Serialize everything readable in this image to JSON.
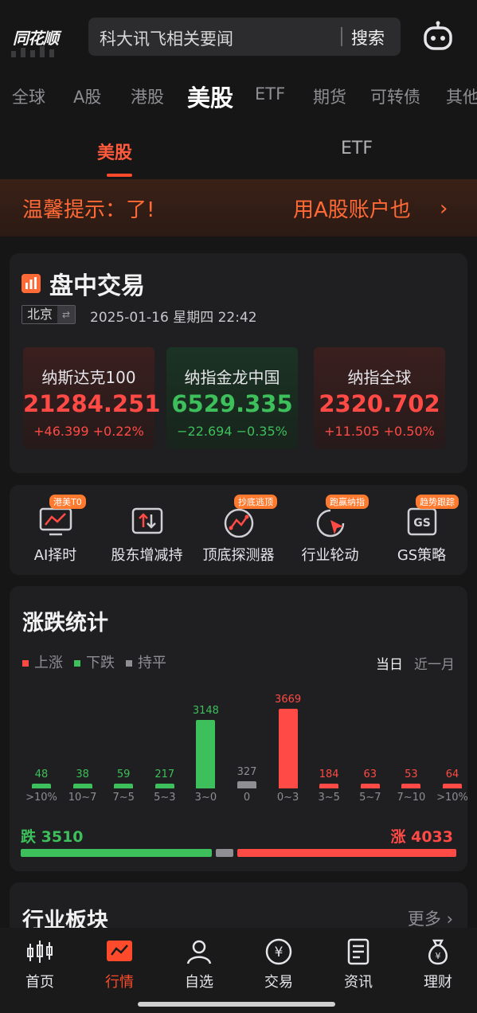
{
  "app": {
    "logo_text": "同花顺"
  },
  "search": {
    "placeholder": "科大讯飞相关要闻",
    "button": "搜索"
  },
  "market_tabs": [
    "全球",
    "A股",
    "港股",
    "美股",
    "ETF",
    "期货",
    "可转债",
    "其他"
  ],
  "market_tabs_active": "美股",
  "sub_tabs": [
    "美股",
    "ETF"
  ],
  "sub_tabs_active": "美股",
  "notice": {
    "left_text": "温馨提示：了!",
    "right_text": "用A股账户也"
  },
  "intraday": {
    "title": "盘中交易",
    "city": "北京",
    "datetime": "2025-01-16 星期四   22:42",
    "indices": [
      {
        "name": "纳斯达克100",
        "value": "21284.251",
        "change": "+46.399 +0.22%",
        "direction": "up"
      },
      {
        "name": "纳指金龙中国",
        "value": "6529.335",
        "change": "−22.694 −0.35%",
        "direction": "down"
      },
      {
        "name": "纳指全球",
        "value": "2320.702",
        "change": "+11.505 +0.50%",
        "direction": "up"
      }
    ]
  },
  "tools": [
    {
      "label": "AI择时",
      "badge": "港美T0",
      "icon": "monitor-chart-icon"
    },
    {
      "label": "股东增减持",
      "badge": "",
      "icon": "updown-arrows-icon"
    },
    {
      "label": "顶底探测器",
      "badge": "抄底逃顶",
      "icon": "peak-trough-icon"
    },
    {
      "label": "行业轮动",
      "badge": "跑赢纳指",
      "icon": "rotation-cursor-icon"
    },
    {
      "label": "GS策略",
      "badge": "趋势跟踪",
      "icon": "gs-icon"
    }
  ],
  "stats": {
    "title": "涨跌统计",
    "legend": [
      "上涨",
      "下跌",
      "持平"
    ],
    "periods": [
      "当日",
      "近一月"
    ],
    "active_period": "当日",
    "down_total_label": "跌",
    "down_total": "3510",
    "up_total_label": "涨",
    "up_total": "4033",
    "colors": {
      "up": "#ff4a45",
      "down": "#3dbf5b",
      "flat": "#8e8e93"
    }
  },
  "chart_data": {
    "type": "bar",
    "categories": [
      ">10%",
      "10~7",
      "7~5",
      "5~3",
      "3~0",
      "0",
      "0~3",
      "3~5",
      "5~7",
      "7~10",
      ">10%"
    ],
    "values": [
      48,
      38,
      59,
      217,
      3148,
      327,
      3669,
      184,
      63,
      53,
      64
    ],
    "groups": [
      "down",
      "down",
      "down",
      "down",
      "down",
      "flat",
      "up",
      "up",
      "up",
      "up",
      "up"
    ],
    "ratio": {
      "down": 3510,
      "flat": 327,
      "up": 4033
    }
  },
  "sectors": {
    "title": "行业板块",
    "more": "更多"
  },
  "bottom_nav": [
    {
      "label": "首页",
      "icon": "candles-icon"
    },
    {
      "label": "行情",
      "icon": "market-chart-icon"
    },
    {
      "label": "自选",
      "icon": "user-icon"
    },
    {
      "label": "交易",
      "icon": "yen-icon"
    },
    {
      "label": "资讯",
      "icon": "news-icon"
    },
    {
      "label": "理财",
      "icon": "money-bag-icon"
    }
  ],
  "bottom_nav_active": "行情"
}
